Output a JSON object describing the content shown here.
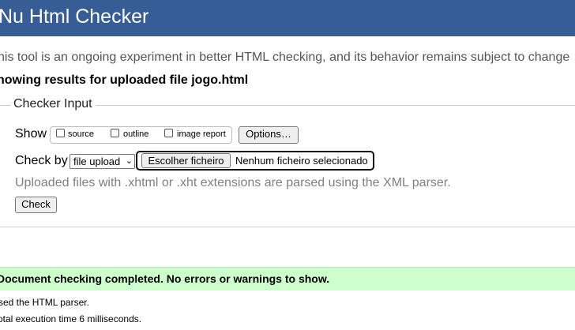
{
  "header": {
    "title": "Nu Html Checker"
  },
  "intro": "his tool is an ongoing experiment in better HTML checking, and its behavior remains subject to change",
  "results_title": "howing results for uploaded file jogo.html",
  "checker": {
    "legend": "Checker Input",
    "show_label": "Show",
    "show_options": [
      {
        "label": "source",
        "checked": false
      },
      {
        "label": "outline",
        "checked": false
      },
      {
        "label": "image report",
        "checked": false
      }
    ],
    "options_button": "Options…",
    "check_by_label": "Check by",
    "check_by_value": "file upload",
    "file_button": "Escolher ficheiro",
    "file_status": "Nenhum ficheiro selecionado",
    "hint": "Uploaded files with .xhtml or .xht extensions are parsed using the XML parser.",
    "check_button": "Check"
  },
  "result": {
    "success": "Document checking completed. No errors or warnings to show.",
    "parser_note": "sed the HTML parser.",
    "timing_note": "otal execution time 6 milliseconds."
  }
}
